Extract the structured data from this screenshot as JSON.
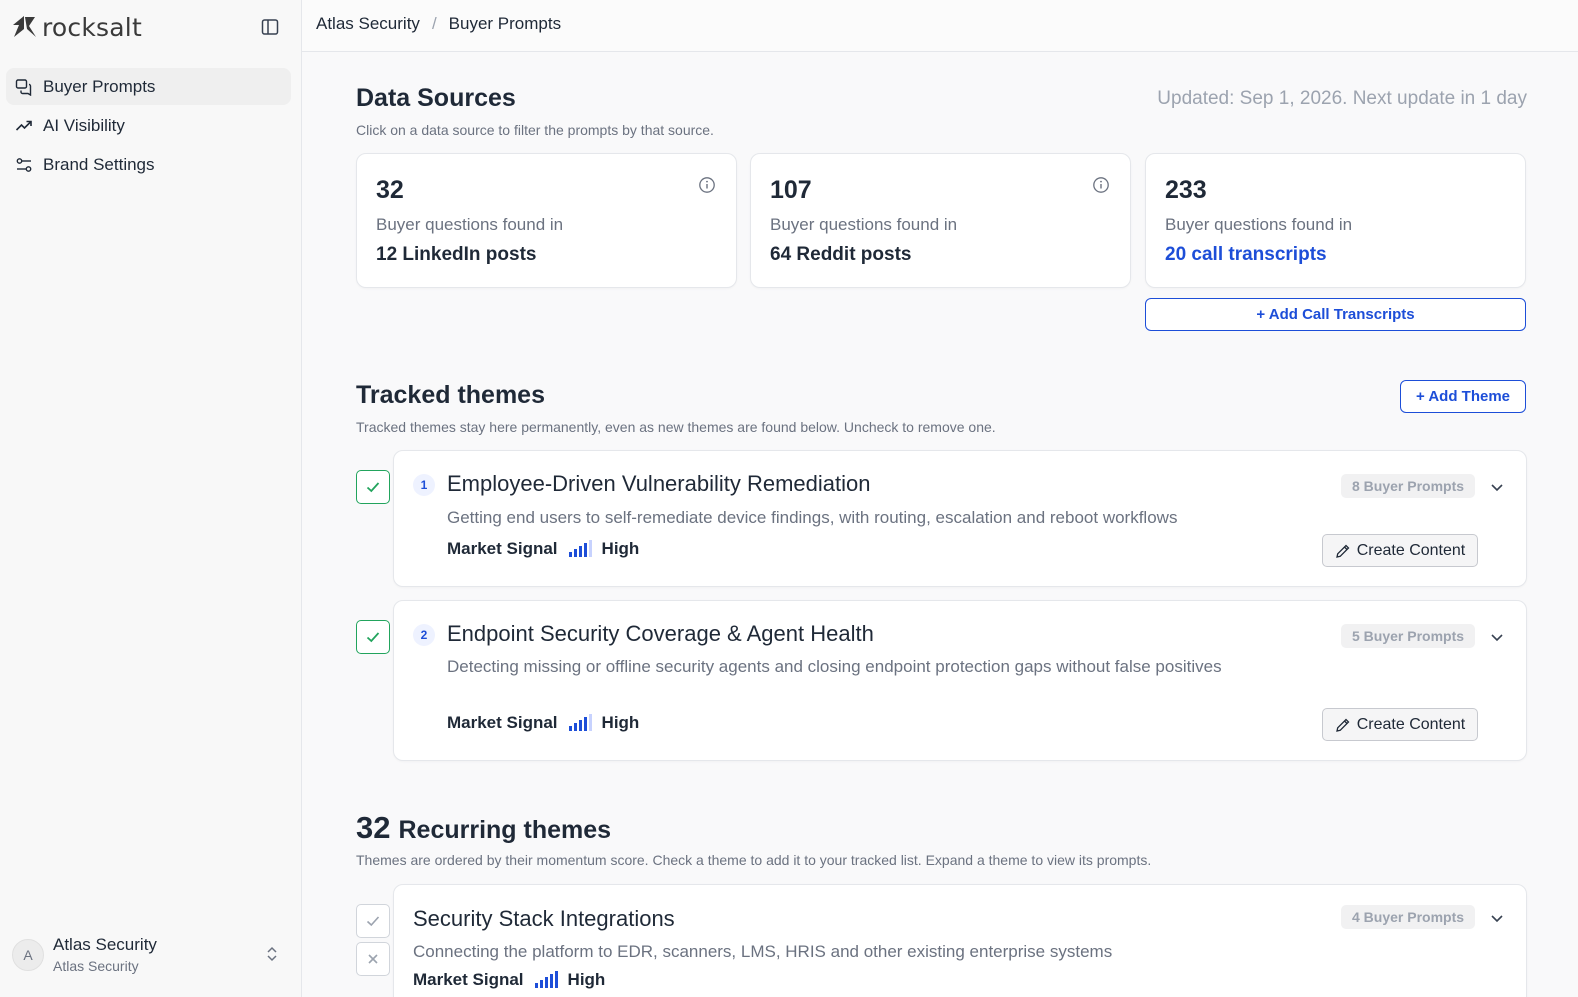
{
  "app": {
    "logo_text": "rocksalt"
  },
  "sidebar": {
    "items": [
      {
        "label": "Buyer Prompts",
        "icon": "chat-bubbles-icon",
        "active": true
      },
      {
        "label": "AI Visibility",
        "icon": "trending-up-icon",
        "active": false
      },
      {
        "label": "Brand Settings",
        "icon": "sliders-icon",
        "active": false
      }
    ],
    "account": {
      "avatar_letter": "A",
      "name": "Atlas Security",
      "org": "Atlas Security"
    }
  },
  "breadcrumb": {
    "org": "Atlas Security",
    "separator": "/",
    "page": "Buyer Prompts"
  },
  "data_sources": {
    "title": "Data Sources",
    "subtitle": "Click on a data source to filter the prompts by that source.",
    "updated": "Updated: Sep 1, 2026. Next update in 1 day",
    "cards": [
      {
        "count": "32",
        "label": "Buyer questions found in",
        "source": "12 LinkedIn posts"
      },
      {
        "count": "107",
        "label": "Buyer questions found in",
        "source": "64 Reddit posts"
      },
      {
        "count": "233",
        "label": "Buyer questions found in",
        "source": "20 call transcripts"
      }
    ],
    "add_transcripts_label": "+ Add Call Transcripts"
  },
  "tracked": {
    "title": "Tracked themes",
    "subtitle": "Tracked themes stay here permanently, even as new themes are found below. Uncheck to remove one.",
    "add_theme_label": "+ Add Theme",
    "themes": [
      {
        "number": "1",
        "title": "Employee-Driven Vulnerability Remediation",
        "description": "Getting end users to self-remediate device findings, with routing, escalation and reboot workflows",
        "signal_label": "Market Signal",
        "signal_value": "High",
        "prompts": "8 Buyer Prompts",
        "create_label": "Create Content"
      },
      {
        "number": "2",
        "title": "Endpoint Security Coverage & Agent Health",
        "description": "Detecting missing or offline security agents and closing endpoint protection gaps without false positives",
        "signal_label": "Market Signal",
        "signal_value": "High",
        "prompts": "5 Buyer Prompts",
        "create_label": "Create Content"
      }
    ]
  },
  "recurring": {
    "count": "32",
    "title": "Recurring themes",
    "subtitle": "Themes are ordered by their momentum score. Check a theme to add it to your tracked list. Expand a theme to view its prompts.",
    "themes": [
      {
        "title": "Security Stack Integrations",
        "description": "Connecting the platform to EDR, scanners, LMS, HRIS and other existing enterprise systems",
        "signal_label": "Market Signal",
        "signal_value": "High",
        "prompts": "4 Buyer Prompts"
      }
    ]
  },
  "colors": {
    "accent": "#1d4ed8",
    "check_green": "#22a45d"
  }
}
